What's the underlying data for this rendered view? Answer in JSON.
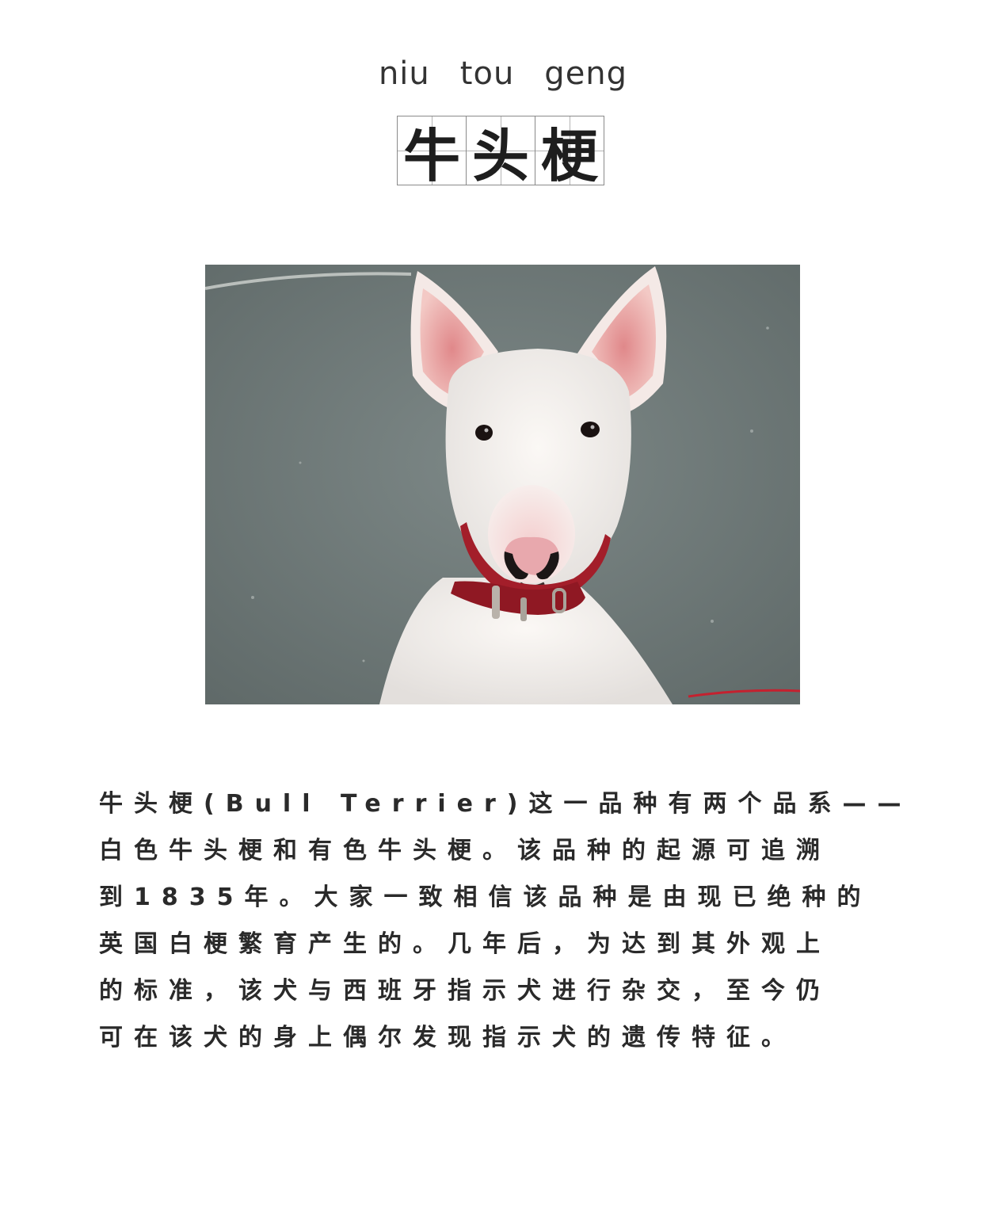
{
  "header": {
    "pinyin": [
      "niu",
      "tou",
      "geng"
    ],
    "title_chars": [
      "牛",
      "头",
      "梗"
    ]
  },
  "photo": {
    "subject": "white bull terrier with red collar",
    "background_color": "#6f7a7a"
  },
  "description": {
    "lines": [
      "牛头梗(Bull Terrier)这一品种有两个品系——",
      "白色牛头梗和有色牛头梗。该品种的起源可追溯",
      "到1835年。大家一致相信该品种是由现已绝种的",
      "英国白梗繁育产生的。几年后，为达到其外观上",
      "的标准，该犬与西班牙指示犬进行杂交，至今仍",
      "可在该犬的身上偶尔发现指示犬的遗传特征。"
    ]
  }
}
